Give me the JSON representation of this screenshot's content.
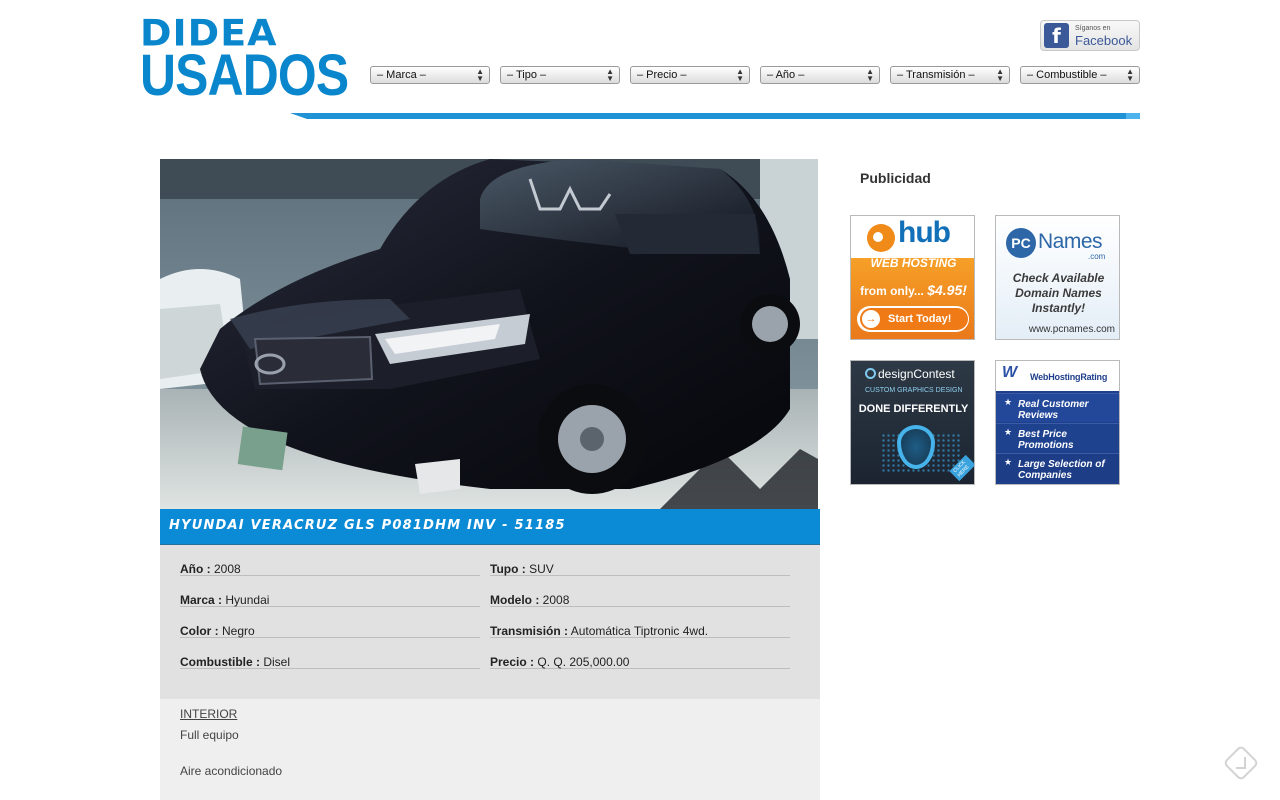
{
  "header": {
    "logo_top": "DIDEA",
    "logo_bottom": "USADOS",
    "facebook_small": "Síganos en",
    "facebook_big": "Facebook"
  },
  "filters": [
    {
      "label": "– Marca –"
    },
    {
      "label": "– Tipo –"
    },
    {
      "label": "– Precio –"
    },
    {
      "label": "– Año –"
    },
    {
      "label": "– Transmisión –"
    },
    {
      "label": "– Combustible –"
    }
  ],
  "listing": {
    "title": "HYUNDAI VERACRUZ GLS P081DHM INV - 51185",
    "specs": [
      {
        "label": "Año :",
        "value": "2008"
      },
      {
        "label": "Tupo :",
        "value": "SUV"
      },
      {
        "label": "Marca :",
        "value": "Hyundai"
      },
      {
        "label": "Modelo :",
        "value": "2008"
      },
      {
        "label": "Color :",
        "value": "Negro"
      },
      {
        "label": "Transmisión :",
        "value": "Automática Tiptronic 4wd."
      },
      {
        "label": "Combustible :",
        "value": "Disel"
      },
      {
        "label": "Precio :",
        "value": "Q. Q. 205,000.00"
      }
    ],
    "notes_heading": "INTERIOR",
    "notes": [
      "Full equipo",
      "Aire acondicionado"
    ]
  },
  "sidebar": {
    "heading": "Publicidad",
    "ads": {
      "hub": {
        "brand": "hub",
        "line1": "WEB HOSTING",
        "from": "from only...",
        "price": "$4.95!",
        "cta": "Start Today!"
      },
      "pcnames": {
        "pc": "PC",
        "brand": "Names",
        "tld": ".com",
        "text": "Check Available Domain Names Instantly!",
        "url": "www.pcnames.com"
      },
      "designcontest": {
        "brand": "designContest",
        "sub": "CUSTOM GRAPHICS DESIGN",
        "tagline": "DONE DIFFERENTLY",
        "badge": "CLICK HERE"
      },
      "webhostingrating": {
        "brand": "WebHostingRating",
        "items": [
          "Real Customer Reviews",
          "Best Price Promotions",
          "Large Selection of Companies"
        ]
      }
    }
  },
  "colors": {
    "accent": "#0b8ad6",
    "spec_bg": "#e1e1e1",
    "notes_bg": "#efefef"
  },
  "icons": [
    "facebook-icon",
    "chevron-updown-icon",
    "arrow-right-icon",
    "star-icon",
    "corner-tag-icon"
  ]
}
